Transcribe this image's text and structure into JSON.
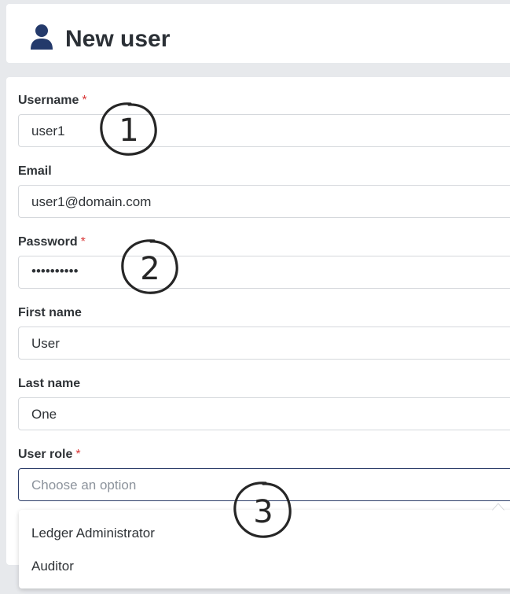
{
  "header": {
    "icon": "user-icon",
    "title": "New user"
  },
  "form": {
    "username": {
      "label": "Username",
      "required_mark": "*",
      "value": "user1"
    },
    "email": {
      "label": "Email",
      "value": "user1@domain.com"
    },
    "password": {
      "label": "Password",
      "required_mark": "*",
      "value": "••••••••••"
    },
    "first_name": {
      "label": "First name",
      "value": "User"
    },
    "last_name": {
      "label": "Last name",
      "value": "One"
    },
    "user_role": {
      "label": "User role",
      "required_mark": "*",
      "placeholder": "Choose an option",
      "options": [
        "Ledger Administrator",
        "Auditor"
      ]
    }
  },
  "annotations": [
    "1",
    "2",
    "3"
  ],
  "colors": {
    "accent": "#2e3f6b",
    "required": "#d93838",
    "background": "#e7e9ec"
  }
}
